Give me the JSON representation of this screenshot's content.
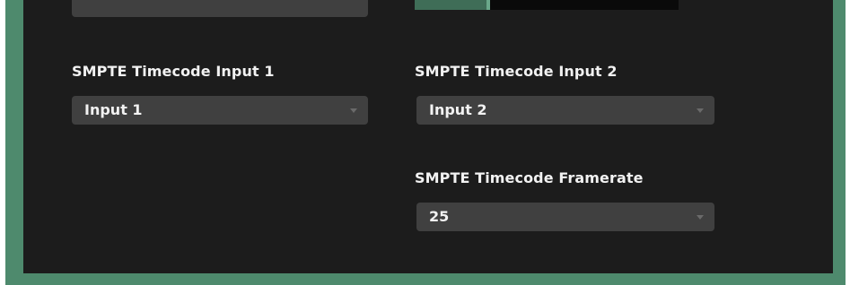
{
  "colors": {
    "panel_background": "#1c1c1c",
    "frame_accent": "#4e8a6d",
    "select_background": "#404040",
    "text": "#f2f2f2"
  },
  "smpte": {
    "input1": {
      "label": "SMPTE Timecode Input 1",
      "selected": "Input 1",
      "icon": "chevron-down-icon"
    },
    "input2": {
      "label": "SMPTE Timecode Input 2",
      "selected": "Input 2",
      "icon": "chevron-down-icon"
    },
    "framerate": {
      "label": "SMPTE Timecode Framerate",
      "selected": "25",
      "icon": "chevron-down-icon"
    }
  }
}
